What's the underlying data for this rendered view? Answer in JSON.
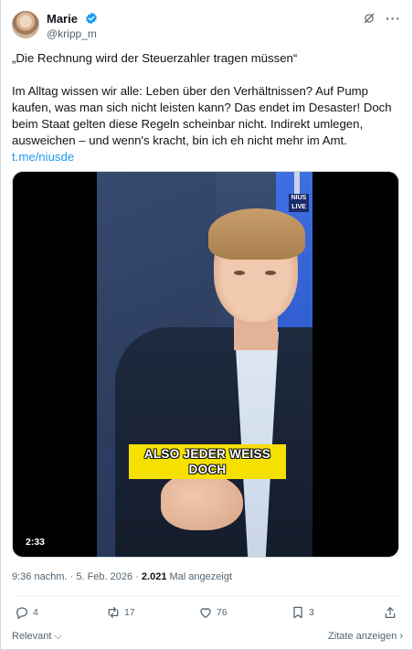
{
  "author": {
    "name": "Marie",
    "handle": "@kripp_m",
    "verified": true
  },
  "tweet": {
    "quote": "„Die Rechnung wird der Steuerzahler tragen müssen“",
    "body_lines": [
      "Im Alltag wissen wir alle: Leben über den Verhältnissen? Auf Pump",
      "kaufen, was man sich nicht leisten kann? Das endet im Desaster! Doch",
      "beim Staat gelten diese Regeln scheinbar nicht. Indirekt umlegen,",
      "ausweichen – und wenn's kracht, bin ich eh nicht mehr im Amt."
    ],
    "link": "t.me/niusde"
  },
  "video": {
    "caption_line1": "ALSO JEDER WEISS",
    "caption_line2": "DOCH",
    "duration": "2:33",
    "logo_text_1": "NIUS",
    "logo_text_2": "LIVE"
  },
  "meta": {
    "time": "9:36 nachm.",
    "separator": "·",
    "date": "5. Feb. 2026",
    "views_count": "2.021",
    "views_label": "Mal angezeigt"
  },
  "actions": {
    "replies": "4",
    "reposts": "17",
    "likes": "76",
    "bookmarks": "3"
  },
  "footer": {
    "sort_label": "Relevant",
    "quotes_label": "Zitate anzeigen"
  },
  "colors": {
    "accent": "#1d9bf0",
    "text": "#0f1419",
    "muted": "#536471",
    "caption_bg": "#f5e000"
  }
}
